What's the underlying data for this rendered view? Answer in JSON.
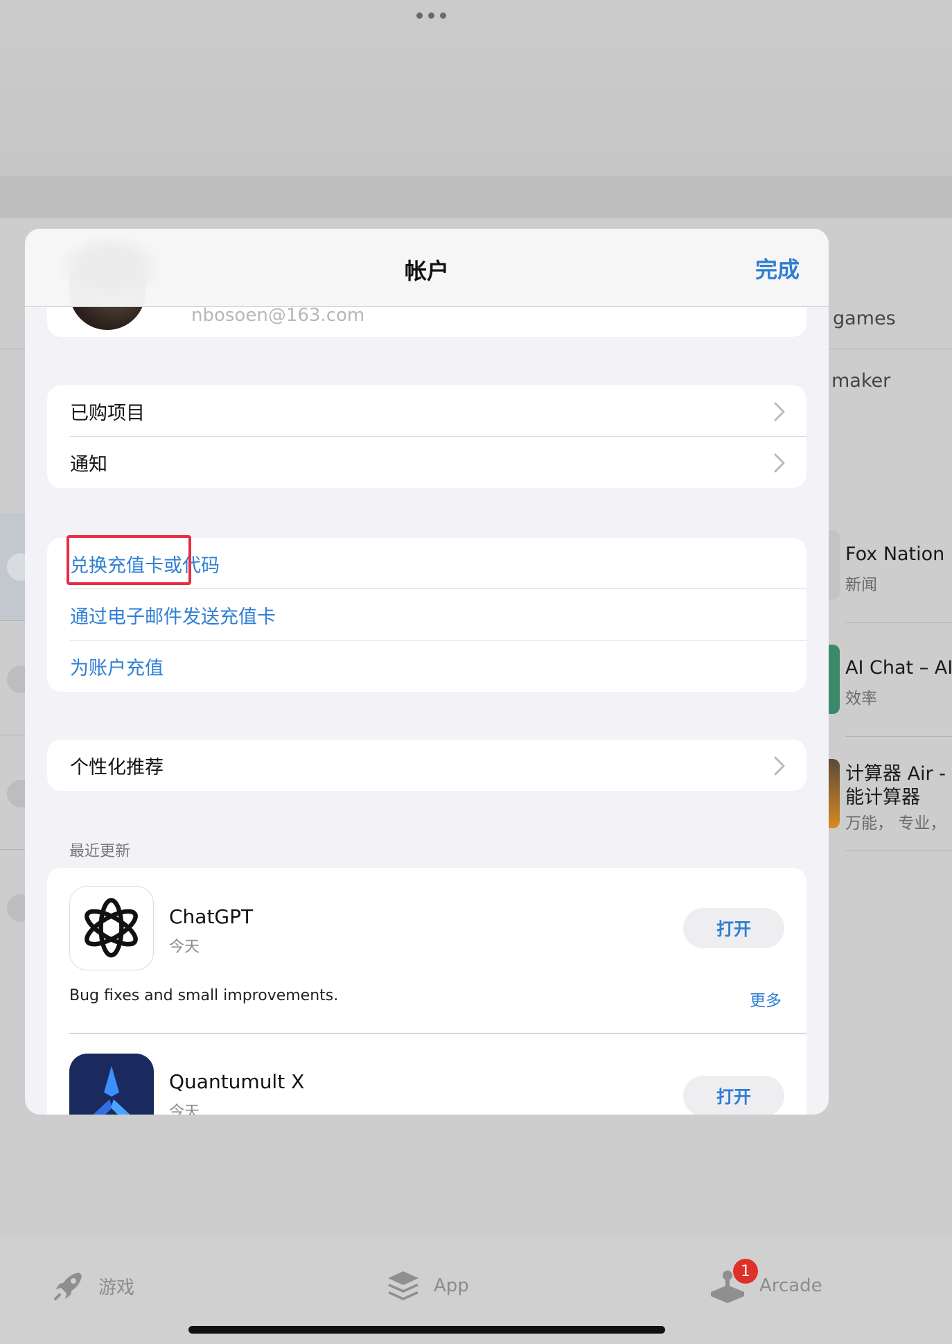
{
  "sheet": {
    "title": "帐户",
    "done_label": "完成",
    "profile_email": "nbosoen@163.com",
    "group1": [
      {
        "label": "已购项目"
      },
      {
        "label": "通知"
      }
    ],
    "group2": [
      {
        "label": "兑换充值卡或代码"
      },
      {
        "label": "通过电子邮件发送充值卡"
      },
      {
        "label": "为账户充值"
      }
    ],
    "group3": [
      {
        "label": "个性化推荐"
      }
    ],
    "recent_updates_header": "最近更新",
    "updates": [
      {
        "name": "ChatGPT",
        "date": "今天",
        "button": "打开",
        "notes": "Bug fixes and small improvements.",
        "more": "更多"
      },
      {
        "name": "Quantumult X",
        "date": "今天",
        "button": "打开"
      }
    ]
  },
  "background": {
    "items": [
      {
        "text": "games"
      },
      {
        "text": "maker"
      },
      {
        "title": "Fox Nation",
        "subtitle": "新闻"
      },
      {
        "title": "AI Chat – AI",
        "subtitle": "效率"
      },
      {
        "title": "计算器 Air -",
        "title2": "能计算器",
        "subtitle": "万能， 专业，"
      }
    ]
  },
  "tabbar": {
    "tabs": [
      {
        "label": "游戏",
        "icon": "rocket-icon"
      },
      {
        "label": "App",
        "icon": "stack-icon"
      },
      {
        "label": "Arcade",
        "icon": "joystick-icon",
        "badge": "1"
      }
    ]
  },
  "colors": {
    "accent": "#2f7fd4",
    "highlight": "#e52d44",
    "badge": "#e0302a"
  }
}
